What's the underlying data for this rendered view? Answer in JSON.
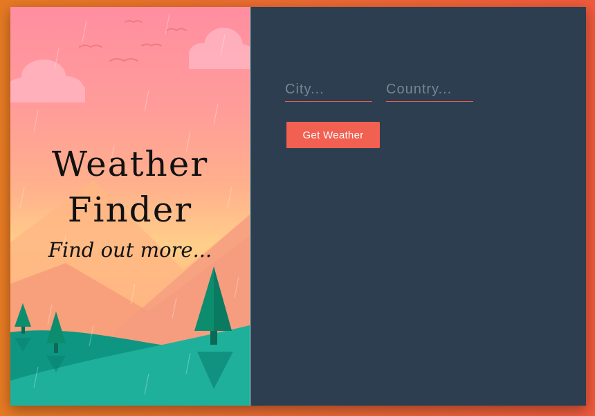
{
  "hero": {
    "title_line1": "Weather",
    "title_line2": "Finder",
    "subtitle": "Find out more..."
  },
  "form": {
    "city_placeholder": "City...",
    "country_placeholder": "Country...",
    "submit_label": "Get Weather"
  },
  "colors": {
    "accent": "#f16051",
    "form_background": "#2c3e50",
    "page_background": "#ea6a32"
  }
}
